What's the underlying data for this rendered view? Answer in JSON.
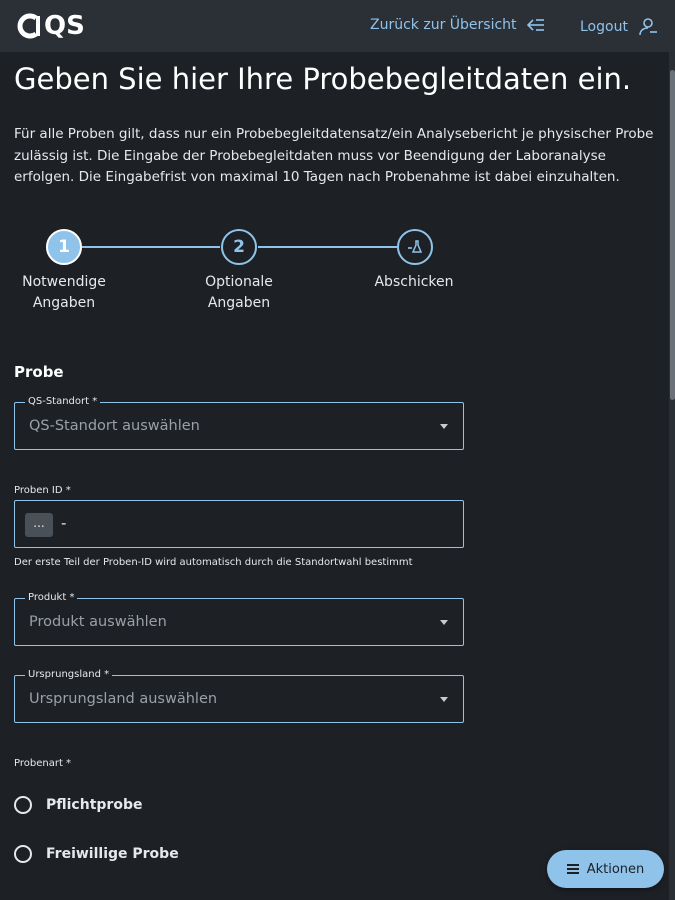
{
  "header": {
    "logo_text": "QS",
    "back_label": "Zurück zur Übersicht",
    "logout_label": "Logout"
  },
  "page": {
    "title": "Geben Sie hier Ihre Probebegleitdaten ein.",
    "intro": "Für alle Proben gilt, dass nur ein Probebegleitdatensatz/ein Analysebericht je physischer Probe zulässig ist. Die Eingabe der Probebegleitdaten muss vor Beendigung der Laboranalyse erfolgen. Die Eingabefrist von maximal 10 Tagen nach Probenahme ist dabei einzuhalten."
  },
  "stepper": {
    "steps": [
      {
        "number": "1",
        "label": "Notwendige Angaben",
        "state": "active"
      },
      {
        "number": "2",
        "label": "Optionale Angaben",
        "state": "inactive"
      },
      {
        "number": "",
        "icon": "flask-icon",
        "label": "Abschicken",
        "state": "inactive"
      }
    ]
  },
  "form": {
    "section_title": "Probe",
    "qs_standort": {
      "label": "QS-Standort *",
      "placeholder": "QS-Standort auswählen"
    },
    "proben_id": {
      "label": "Proben ID *",
      "prefix": "...",
      "separator": "-",
      "helper": "Der erste Teil der Proben-ID wird automatisch durch die Standortwahl bestimmt"
    },
    "produkt": {
      "label": "Produkt *",
      "placeholder": "Produkt auswählen"
    },
    "ursprungsland": {
      "label": "Ursprungsland *",
      "placeholder": "Ursprungsland auswählen"
    },
    "probenart": {
      "label": "Probenart *",
      "options": [
        "Pflichtprobe",
        "Freiwillige Probe"
      ]
    }
  },
  "actions": {
    "label": "Aktionen"
  },
  "colors": {
    "accent": "#8fc3ea",
    "background": "#1d2126",
    "header": "#2b3037"
  }
}
